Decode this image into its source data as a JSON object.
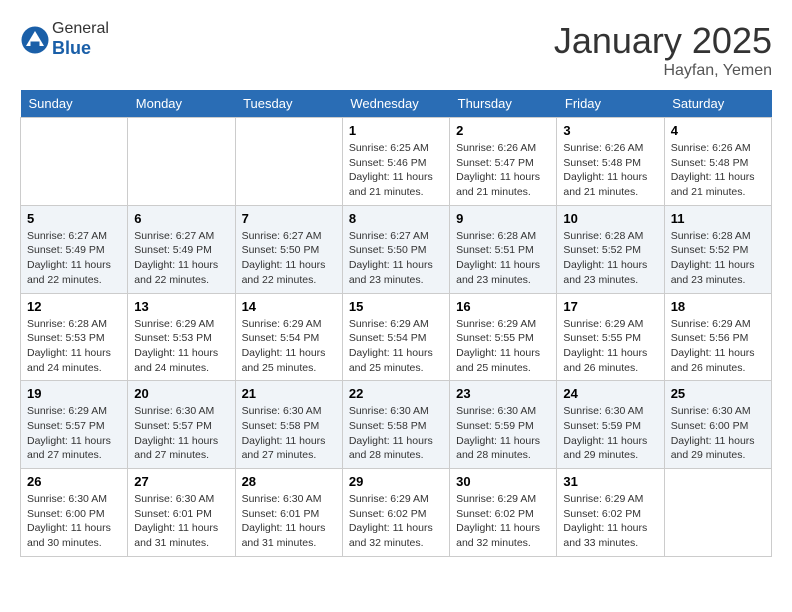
{
  "header": {
    "logo_general": "General",
    "logo_blue": "Blue",
    "month": "January 2025",
    "location": "Hayfan, Yemen"
  },
  "weekdays": [
    "Sunday",
    "Monday",
    "Tuesday",
    "Wednesday",
    "Thursday",
    "Friday",
    "Saturday"
  ],
  "weeks": [
    [
      {
        "day": "",
        "info": ""
      },
      {
        "day": "",
        "info": ""
      },
      {
        "day": "",
        "info": ""
      },
      {
        "day": "1",
        "info": "Sunrise: 6:25 AM\nSunset: 5:46 PM\nDaylight: 11 hours and 21 minutes."
      },
      {
        "day": "2",
        "info": "Sunrise: 6:26 AM\nSunset: 5:47 PM\nDaylight: 11 hours and 21 minutes."
      },
      {
        "day": "3",
        "info": "Sunrise: 6:26 AM\nSunset: 5:48 PM\nDaylight: 11 hours and 21 minutes."
      },
      {
        "day": "4",
        "info": "Sunrise: 6:26 AM\nSunset: 5:48 PM\nDaylight: 11 hours and 21 minutes."
      }
    ],
    [
      {
        "day": "5",
        "info": "Sunrise: 6:27 AM\nSunset: 5:49 PM\nDaylight: 11 hours and 22 minutes."
      },
      {
        "day": "6",
        "info": "Sunrise: 6:27 AM\nSunset: 5:49 PM\nDaylight: 11 hours and 22 minutes."
      },
      {
        "day": "7",
        "info": "Sunrise: 6:27 AM\nSunset: 5:50 PM\nDaylight: 11 hours and 22 minutes."
      },
      {
        "day": "8",
        "info": "Sunrise: 6:27 AM\nSunset: 5:50 PM\nDaylight: 11 hours and 23 minutes."
      },
      {
        "day": "9",
        "info": "Sunrise: 6:28 AM\nSunset: 5:51 PM\nDaylight: 11 hours and 23 minutes."
      },
      {
        "day": "10",
        "info": "Sunrise: 6:28 AM\nSunset: 5:52 PM\nDaylight: 11 hours and 23 minutes."
      },
      {
        "day": "11",
        "info": "Sunrise: 6:28 AM\nSunset: 5:52 PM\nDaylight: 11 hours and 23 minutes."
      }
    ],
    [
      {
        "day": "12",
        "info": "Sunrise: 6:28 AM\nSunset: 5:53 PM\nDaylight: 11 hours and 24 minutes."
      },
      {
        "day": "13",
        "info": "Sunrise: 6:29 AM\nSunset: 5:53 PM\nDaylight: 11 hours and 24 minutes."
      },
      {
        "day": "14",
        "info": "Sunrise: 6:29 AM\nSunset: 5:54 PM\nDaylight: 11 hours and 25 minutes."
      },
      {
        "day": "15",
        "info": "Sunrise: 6:29 AM\nSunset: 5:54 PM\nDaylight: 11 hours and 25 minutes."
      },
      {
        "day": "16",
        "info": "Sunrise: 6:29 AM\nSunset: 5:55 PM\nDaylight: 11 hours and 25 minutes."
      },
      {
        "day": "17",
        "info": "Sunrise: 6:29 AM\nSunset: 5:55 PM\nDaylight: 11 hours and 26 minutes."
      },
      {
        "day": "18",
        "info": "Sunrise: 6:29 AM\nSunset: 5:56 PM\nDaylight: 11 hours and 26 minutes."
      }
    ],
    [
      {
        "day": "19",
        "info": "Sunrise: 6:29 AM\nSunset: 5:57 PM\nDaylight: 11 hours and 27 minutes."
      },
      {
        "day": "20",
        "info": "Sunrise: 6:30 AM\nSunset: 5:57 PM\nDaylight: 11 hours and 27 minutes."
      },
      {
        "day": "21",
        "info": "Sunrise: 6:30 AM\nSunset: 5:58 PM\nDaylight: 11 hours and 27 minutes."
      },
      {
        "day": "22",
        "info": "Sunrise: 6:30 AM\nSunset: 5:58 PM\nDaylight: 11 hours and 28 minutes."
      },
      {
        "day": "23",
        "info": "Sunrise: 6:30 AM\nSunset: 5:59 PM\nDaylight: 11 hours and 28 minutes."
      },
      {
        "day": "24",
        "info": "Sunrise: 6:30 AM\nSunset: 5:59 PM\nDaylight: 11 hours and 29 minutes."
      },
      {
        "day": "25",
        "info": "Sunrise: 6:30 AM\nSunset: 6:00 PM\nDaylight: 11 hours and 29 minutes."
      }
    ],
    [
      {
        "day": "26",
        "info": "Sunrise: 6:30 AM\nSunset: 6:00 PM\nDaylight: 11 hours and 30 minutes."
      },
      {
        "day": "27",
        "info": "Sunrise: 6:30 AM\nSunset: 6:01 PM\nDaylight: 11 hours and 31 minutes."
      },
      {
        "day": "28",
        "info": "Sunrise: 6:30 AM\nSunset: 6:01 PM\nDaylight: 11 hours and 31 minutes."
      },
      {
        "day": "29",
        "info": "Sunrise: 6:29 AM\nSunset: 6:02 PM\nDaylight: 11 hours and 32 minutes."
      },
      {
        "day": "30",
        "info": "Sunrise: 6:29 AM\nSunset: 6:02 PM\nDaylight: 11 hours and 32 minutes."
      },
      {
        "day": "31",
        "info": "Sunrise: 6:29 AM\nSunset: 6:02 PM\nDaylight: 11 hours and 33 minutes."
      },
      {
        "day": "",
        "info": ""
      }
    ]
  ]
}
